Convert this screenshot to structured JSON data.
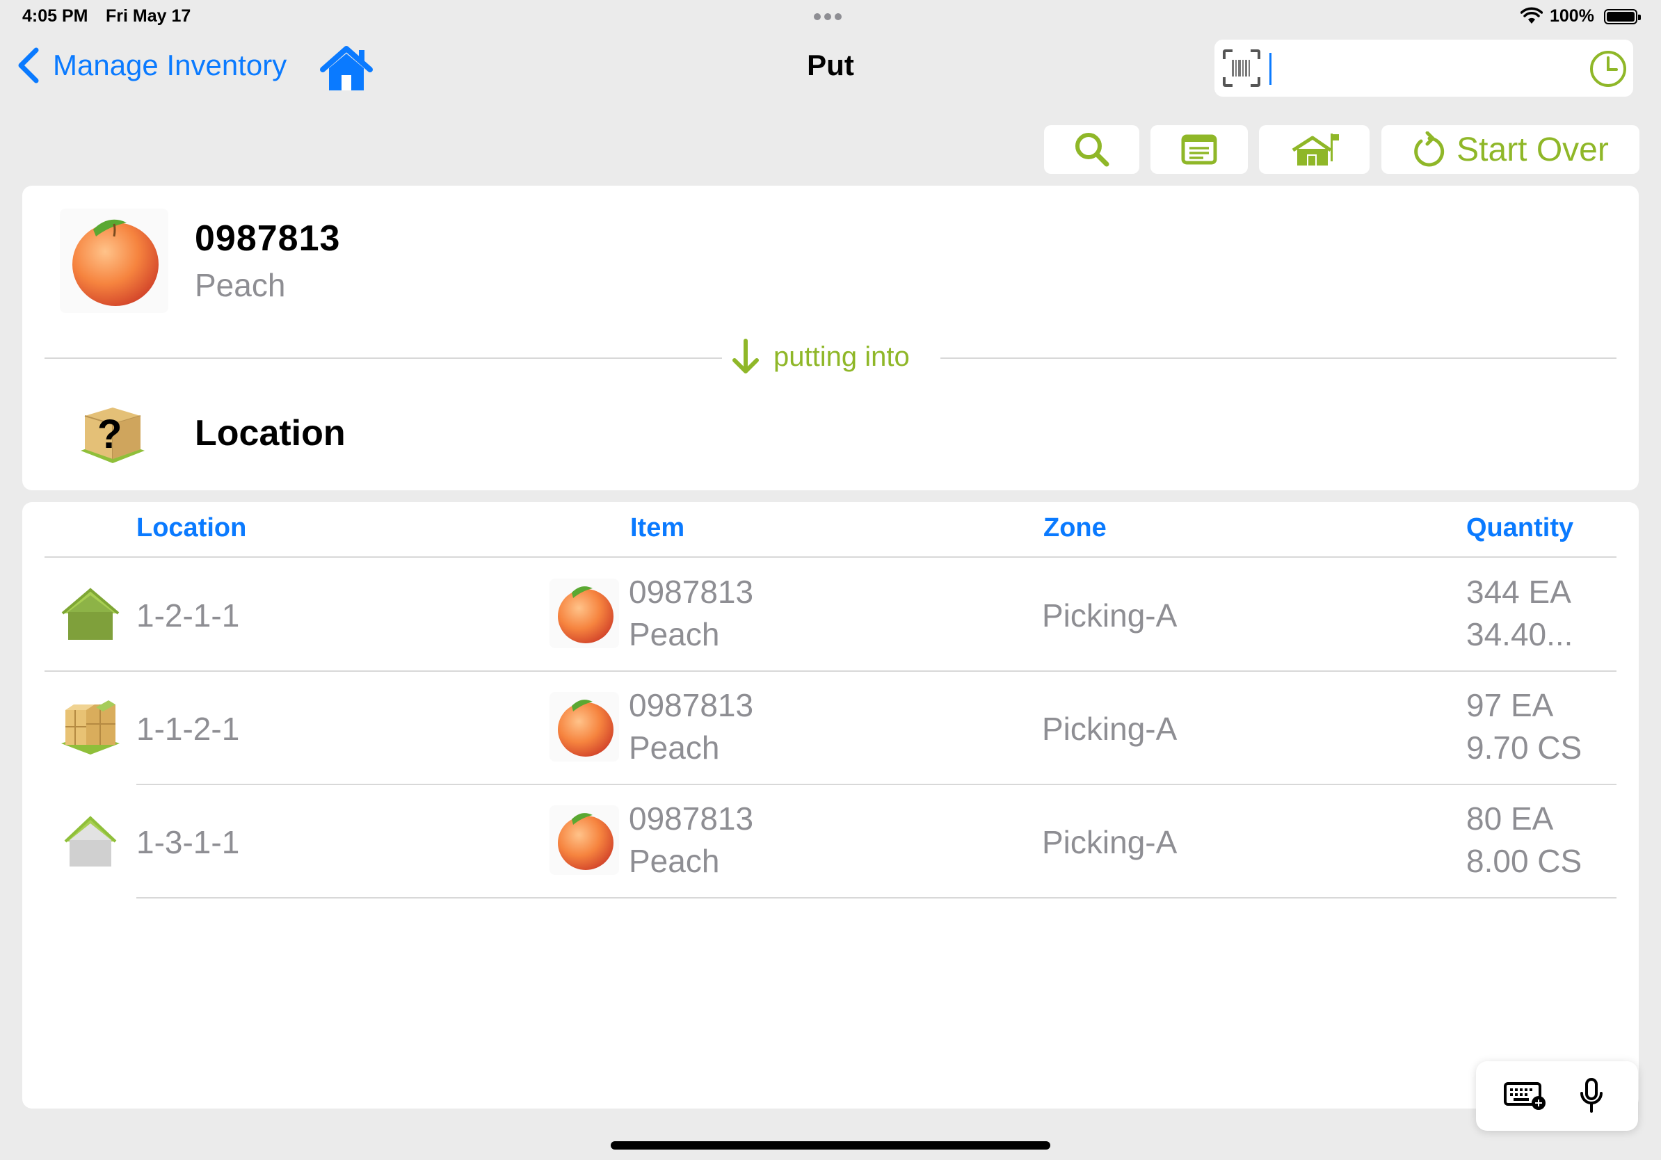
{
  "status_bar": {
    "time": "4:05 PM",
    "date": "Fri May 17",
    "battery": "100%"
  },
  "nav": {
    "back_label": "Manage Inventory",
    "title": "Put",
    "search_value": ""
  },
  "toolbar": {
    "start_over_label": "Start Over"
  },
  "product": {
    "code": "0987813",
    "name": "Peach"
  },
  "putting_label": "putting into",
  "location_title": "Location",
  "table": {
    "headers": {
      "location": "Location",
      "item": "Item",
      "zone": "Zone",
      "quantity": "Quantity"
    },
    "rows": [
      {
        "location": "1-2-1-1",
        "code": "0987813",
        "name": "Peach",
        "zone": "Picking-A",
        "qty1": "344 EA",
        "qty2": "34.40...",
        "icon": "green-house-icon"
      },
      {
        "location": "1-1-2-1",
        "code": "0987813",
        "name": "Peach",
        "zone": "Picking-A",
        "qty1": "97 EA",
        "qty2": "9.70 CS",
        "icon": "boxes-icon"
      },
      {
        "location": "1-3-1-1",
        "code": "0987813",
        "name": "Peach",
        "zone": "Picking-A",
        "qty1": "80 EA",
        "qty2": "8.00 CS",
        "icon": "gray-house-icon"
      }
    ]
  },
  "colors": {
    "accent_blue": "#0a7aff",
    "accent_green": "#8fb728",
    "secondary_text": "#8e8e93"
  }
}
